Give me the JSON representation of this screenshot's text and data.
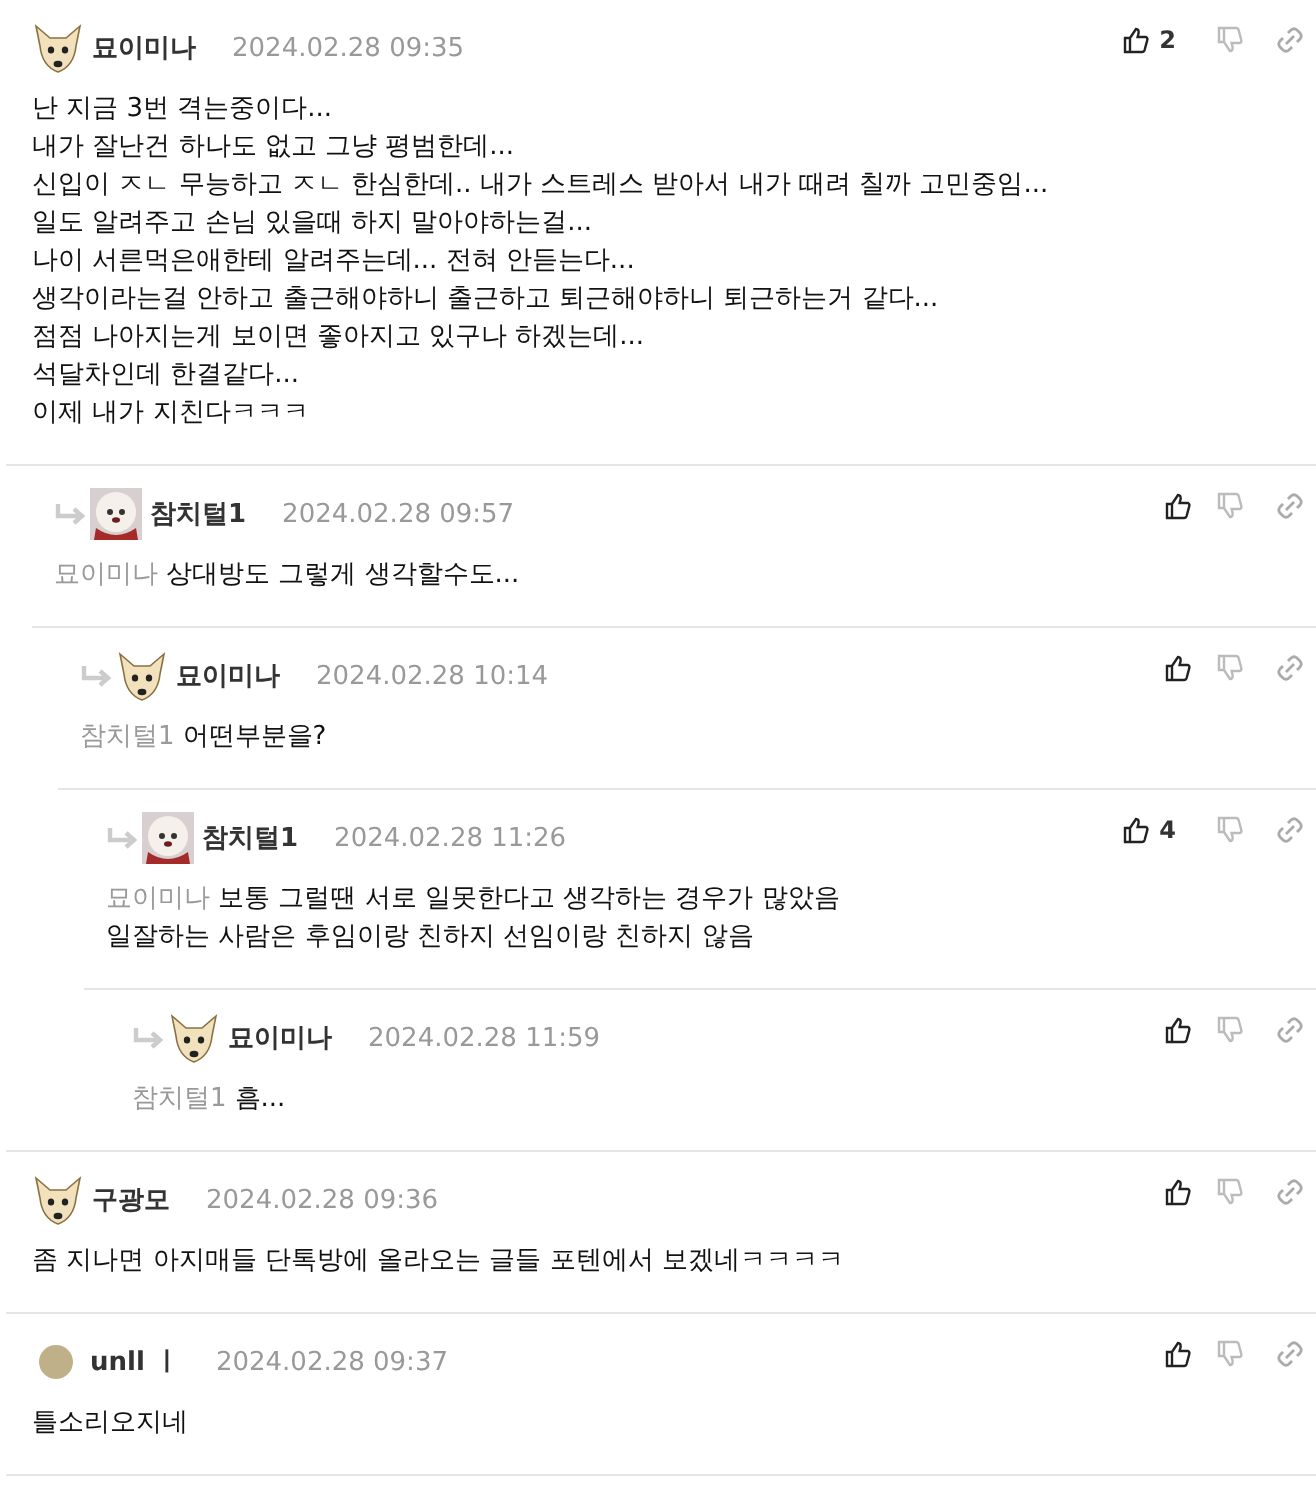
{
  "comments": [
    {
      "author": "묘이미나",
      "kind": "dog",
      "date": "2024.02.28 09:35",
      "likes": "2",
      "text": "난 지금 3번 격는중이다...\n내가 잘난건 하나도 없고 그냥 평범한데...\n신입이 ㅈㄴ 무능하고 ㅈㄴ 한심한데.. 내가 스트레스 받아서 내가 때려 칠까 고민중임...\n일도 알려주고 손님 있을때 하지 말아야하는걸...\n나이 서른먹은애한테 알려주는데... 전혀 안듣는다...\n생각이라는걸 안하고 출근해야하니 출근하고 퇴근해야하니 퇴근하는거 같다...\n점점 나아지는게 보이면 좋아지고 있구나 하겠는데...\n석달차인데 한결같다...\n이제 내가 지친다ㅋㅋㅋ",
      "children": [
        {
          "author": "참치털1",
          "kind": "puppy",
          "date": "2024.02.28 09:57",
          "mention": "묘이미나",
          "text": "상대방도 그렇게 생각할수도...",
          "children": [
            {
              "author": "묘이미나",
              "kind": "dog",
              "date": "2024.02.28 10:14",
              "mention": "참치털1",
              "text": "어떤부분을?",
              "children": [
                {
                  "author": "참치털1",
                  "kind": "puppy",
                  "date": "2024.02.28 11:26",
                  "likes": "4",
                  "mention": "묘이미나",
                  "text": "보통 그럴땐 서로 일못한다고 생각하는 경우가 많았음\n일잘하는 사람은 후임이랑 친하지 선임이랑 친하지 않음",
                  "children": [
                    {
                      "author": "묘이미나",
                      "kind": "dog",
                      "date": "2024.02.28 11:59",
                      "mention": "참치털1",
                      "text": "흠..."
                    }
                  ]
                }
              ]
            }
          ]
        }
      ]
    },
    {
      "author": "구광모",
      "kind": "dog",
      "date": "2024.02.28 09:36",
      "text": "좀 지나면 아지매들 단톡방에 올라오는 글들 포텐에서 보겠네ㅋㅋㅋㅋ"
    },
    {
      "author": "unll ㅣ",
      "kind": "circle",
      "date": "2024.02.28 09:37",
      "text": "틀소리오지네"
    }
  ]
}
